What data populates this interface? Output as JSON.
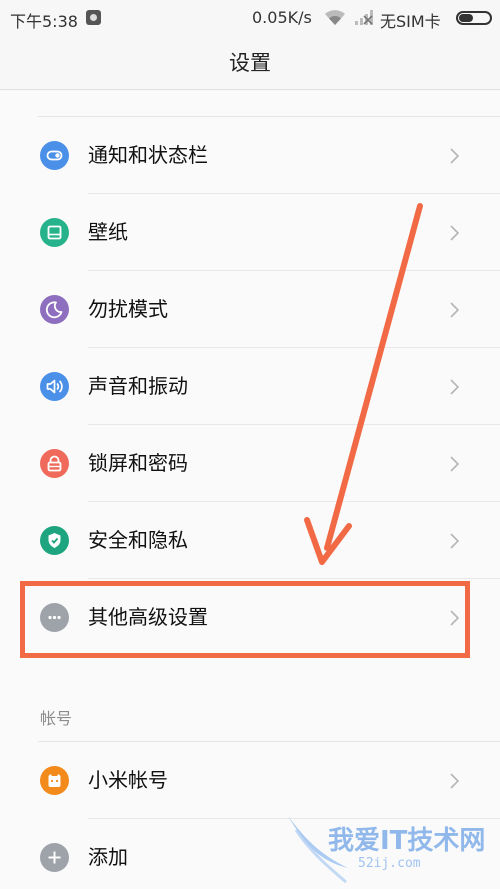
{
  "status_bar": {
    "time": "下午5:38",
    "network_speed": "0.05K/s",
    "sim_status": "无SIM卡"
  },
  "header": {
    "title": "设置"
  },
  "settings": [
    {
      "label": "通知和状态栏",
      "icon": "notification-toggle-icon",
      "color": "#4a90e8"
    },
    {
      "label": "壁纸",
      "icon": "wallpaper-icon",
      "color": "#26b38b"
    },
    {
      "label": "勿扰模式",
      "icon": "moon-icon",
      "color": "#8e6fbf"
    },
    {
      "label": "声音和振动",
      "icon": "speaker-icon",
      "color": "#4a90e8"
    },
    {
      "label": "锁屏和密码",
      "icon": "lock-icon",
      "color": "#ef6a5a"
    },
    {
      "label": "安全和隐私",
      "icon": "shield-icon",
      "color": "#1ea57f"
    },
    {
      "label": "其他高级设置",
      "icon": "more-icon",
      "color": "#9ea3aa"
    }
  ],
  "account_section": {
    "header": "帐号",
    "items": [
      {
        "label": "小米帐号",
        "icon": "mi-account-icon",
        "color": "#f28a1c"
      },
      {
        "label": "添加",
        "icon": "plus-icon",
        "color": "#9ea3aa"
      }
    ]
  },
  "annotation": {
    "highlight_color": "#f26a45"
  },
  "watermark": {
    "text": "我爱IT技术网",
    "subtext": "52ij.com"
  }
}
